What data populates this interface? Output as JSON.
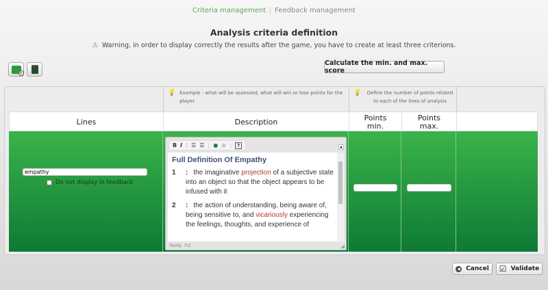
{
  "tabs": [
    {
      "label": "Criteria management",
      "active": true
    },
    {
      "label": "Feedback management",
      "active": false
    }
  ],
  "title": "Analysis criteria definition",
  "warning": "Warning, in order to display correctly the results after the game, you have to create at least three criterions.",
  "toolbar": {
    "add_icon": "add-line-icon",
    "delete_icon": "trash-icon",
    "calculate_label": "Calculate the min. and max. score"
  },
  "help": {
    "description": "Example : what will be assessed, what will win or lose points for the player",
    "points": "Define the number of points related to each of the lines of analysis"
  },
  "columns": {
    "lines": "Lines",
    "description": "Description",
    "min": "Points min.",
    "max": "Points max."
  },
  "row": {
    "line_value": "empathy",
    "checkbox_label": "Do not display in feedback",
    "checked": false,
    "min_value": "",
    "max_value": ""
  },
  "editor": {
    "toolbar": [
      "B",
      "I",
      "ordered-list",
      "unordered-list",
      "link",
      "unlink",
      "?"
    ],
    "heading": "Full Definition Of Empathy",
    "def1": {
      "num": "1",
      "sep": ":",
      "pre": "the imaginative ",
      "red": "projection",
      "post": " of a subjective state into an object so that the object appears to be infused with it"
    },
    "def2": {
      "num": "2",
      "sep": ":",
      "pre": "the action of understanding, being aware of, being sensitive to, and ",
      "red": "vicariously",
      "post": " experiencing the feelings, thoughts, and experience of"
    },
    "status": "body  h2"
  },
  "footer": {
    "cancel": "Cancel",
    "validate": "Validate"
  },
  "colors": {
    "accent_green": "#3bb34a",
    "dark_green": "#0e7a36"
  }
}
